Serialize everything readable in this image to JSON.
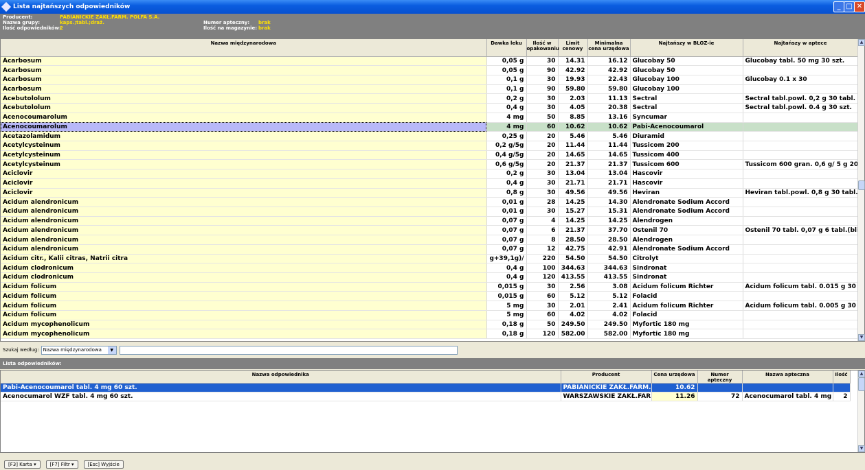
{
  "window": {
    "title": "Lista najtańszych odpowiedników"
  },
  "info": {
    "producent_label": "Producent:",
    "producent": "PABIANICKIE ZAKŁ.FARM. POLFA S.A.",
    "grupa_label": "Nazwa grupy:",
    "grupa": "kaps.;tabl.;draż.",
    "ilosc_label": "Ilość odpowiedników:",
    "ilosc": "2",
    "numer_label": "Numer apteczny:",
    "numer": "brak",
    "magazyn_label": "Ilość na magazynie:",
    "magazyn": "brak"
  },
  "main_table": {
    "headers": [
      "Nazwa międzynarodowa",
      "Dawka leku",
      "Ilość w opakowaniu",
      "Limit cenowy",
      "Minimalna cena urzędowa",
      "Najtańszy w BLOZ-ie",
      "Najtańszy w aptece"
    ],
    "selected_index": 7,
    "rows": [
      [
        "Acarbosum",
        "0,05 g",
        "30",
        "14.31",
        "16.12",
        "Glucobay 50",
        "Glucobay tabl. 50 mg 30 szt."
      ],
      [
        "Acarbosum",
        "0,05 g",
        "90",
        "42.92",
        "42.92",
        "Glucobay 50",
        ""
      ],
      [
        "Acarbosum",
        "0,1 g",
        "30",
        "19.93",
        "22.43",
        "Glucobay 100",
        "Glucobay 0.1 x 30"
      ],
      [
        "Acarbosum",
        "0,1 g",
        "90",
        "59.80",
        "59.80",
        "Glucobay 100",
        ""
      ],
      [
        "Acebutololum",
        "0,2 g",
        "30",
        "2.03",
        "11.13",
        "Sectral",
        "Sectral tabl.powl. 0,2 g 30 tabl."
      ],
      [
        "Acebutololum",
        "0,4 g",
        "30",
        "4.05",
        "20.38",
        "Sectral",
        "Sectral tabl.powl. 0.4 g 30 szt."
      ],
      [
        "Acenocoumarolum",
        "4 mg",
        "50",
        "8.85",
        "13.16",
        "Syncumar",
        ""
      ],
      [
        "Acenocoumarolum",
        "4 mg",
        "60",
        "10.62",
        "10.62",
        "Pabi-Acenocoumarol",
        ""
      ],
      [
        "Acetazolamidum",
        "0,25 g",
        "20",
        "5.46",
        "5.46",
        "Diuramid",
        ""
      ],
      [
        "Acetylcysteinum",
        "0,2 g/5g",
        "20",
        "11.44",
        "11.44",
        "Tussicom 200",
        ""
      ],
      [
        "Acetylcysteinum",
        "0,4 g/5g",
        "20",
        "14.65",
        "14.65",
        "Tussicom 400",
        ""
      ],
      [
        "Acetylcysteinum",
        "0,6 g/5g",
        "20",
        "21.37",
        "21.37",
        "Tussicom 600",
        "Tussicom 600 gran. 0,6 g/ 5 g 20 s"
      ],
      [
        "Aciclovir",
        "0,2 g",
        "30",
        "13.04",
        "13.04",
        "Hascovir",
        ""
      ],
      [
        "Aciclovir",
        "0,4 g",
        "30",
        "21.71",
        "21.71",
        "Hascovir",
        ""
      ],
      [
        "Aciclovir",
        "0,8 g",
        "30",
        "49.56",
        "49.56",
        "Heviran",
        "Heviran tabl.powl. 0,8 g 30 tabl.(b"
      ],
      [
        "Acidum alendronicum",
        "0,01 g",
        "28",
        "14.25",
        "14.30",
        "Alendronate Sodium Accord",
        ""
      ],
      [
        "Acidum alendronicum",
        "0,01 g",
        "30",
        "15.27",
        "15.31",
        "Alendronate Sodium Accord",
        ""
      ],
      [
        "Acidum alendronicum",
        "0,07 g",
        "4",
        "14.25",
        "14.25",
        "Alendrogen",
        ""
      ],
      [
        "Acidum alendronicum",
        "0,07 g",
        "6",
        "21.37",
        "37.70",
        "Ostenil 70",
        "Ostenil 70 tabl. 0,07 g 6 tabl.(blist"
      ],
      [
        "Acidum alendronicum",
        "0,07 g",
        "8",
        "28.50",
        "28.50",
        "Alendrogen",
        ""
      ],
      [
        "Acidum alendronicum",
        "0,07 g",
        "12",
        "42.75",
        "42.91",
        "Alendronate Sodium Accord",
        ""
      ],
      [
        "Acidum citr., Kalii citras, Natrii citra",
        "g+39,1g)/",
        "220",
        "54.50",
        "54.50",
        "Citrolyt",
        ""
      ],
      [
        "Acidum clodronicum",
        "0,4 g",
        "100",
        "344.63",
        "344.63",
        "Sindronat",
        ""
      ],
      [
        "Acidum clodronicum",
        "0,4 g",
        "120",
        "413.55",
        "413.55",
        "Sindronat",
        ""
      ],
      [
        "Acidum folicum",
        "0,015 g",
        "30",
        "2.56",
        "3.08",
        "Acidum folicum Richter",
        "Acidum folicum tabl. 0.015 g 30 sz"
      ],
      [
        "Acidum folicum",
        "0,015 g",
        "60",
        "5.12",
        "5.12",
        "Folacid",
        ""
      ],
      [
        "Acidum folicum",
        "5 mg",
        "30",
        "2.01",
        "2.41",
        "Acidum folicum Richter",
        "Acidum folicum tabl. 0.005 g 30 sz"
      ],
      [
        "Acidum folicum",
        "5 mg",
        "60",
        "4.02",
        "4.02",
        "Folacid",
        ""
      ],
      [
        "Acidum mycophenolicum",
        "0,18 g",
        "50",
        "249.50",
        "249.50",
        "Myfortic 180 mg",
        ""
      ],
      [
        "Acidum mycophenolicum",
        "0,18 g",
        "120",
        "582.00",
        "582.00",
        "Myfortic 180 mg",
        ""
      ]
    ]
  },
  "search": {
    "label": "Szukaj według:",
    "selected": "Nazwa międzynarodowa",
    "value": ""
  },
  "sub_label": "Lista odpowiedników:",
  "sub_table": {
    "headers": [
      "Nazwa odpowiednika",
      "Producent",
      "Cena urzędowa",
      "Numer apteczny",
      "Nazwa apteczna",
      "Ilość"
    ],
    "rows": [
      [
        "Pabi-Acenocoumarol tabl. 4 mg 60 szt.",
        "PABIANICKIE ZAKŁ.FARM. P",
        "10.62",
        "",
        "",
        ""
      ],
      [
        "Acenocumarol WZF tabl. 4 mg 60 szt.",
        "WARSZAWSKIE ZAKŁ.FARM.",
        "11.26",
        "72",
        "Acenocumarol tabl. 4 mg 6(",
        "2"
      ]
    ]
  },
  "footer": {
    "karta": "[F3] Karta",
    "filtr": "[F7] Filtr",
    "wyjscie": "[Esc] Wyjście"
  }
}
